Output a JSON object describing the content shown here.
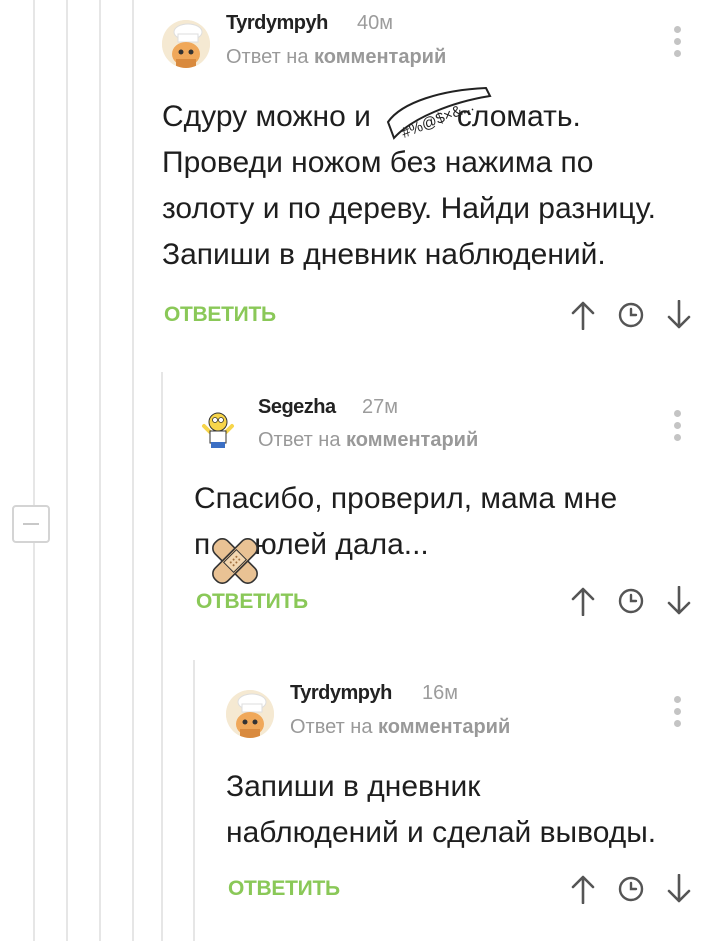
{
  "comments": [
    {
      "author": "Tyrdympyh",
      "time": "40м",
      "reply_prefix": "Ответ на",
      "reply_link": "комментарий",
      "body": [
        "Сдуру можно и",
        "сломать.",
        "Проведи ножом без нажима по",
        "золоту и по дереву. Найди разницу.",
        "Запиши в дневник наблюдений."
      ],
      "censor_sticker": "#%@$×&...",
      "reply_button": "ОТВЕТИТЬ",
      "avatar_icon": "chef-cat-avatar-icon"
    },
    {
      "author": "Segezha",
      "time": "27м",
      "reply_prefix": "Ответ на",
      "reply_link": "комментарий",
      "body": [
        "Спасибо, проверил, мама мне",
        "п",
        "юлей дала..."
      ],
      "censor_sticker": "band-aid-icon",
      "reply_button": "ОТВЕТИТЬ",
      "avatar_icon": "homer-avatar-icon"
    },
    {
      "author": "Tyrdympyh",
      "time": "16м",
      "reply_prefix": "Ответ на",
      "reply_link": "комментарий",
      "body": [
        "Запиши в дневник",
        "наблюдений и сделай выводы."
      ],
      "reply_button": "ОТВЕТИТЬ",
      "avatar_icon": "chef-cat-avatar-icon"
    }
  ],
  "colors": {
    "accent_green": "#8ac858",
    "thread_line": "#e6e6e6",
    "muted_text": "#999999"
  },
  "icons": {
    "upvote": "arrow-up-icon",
    "save": "clock-icon",
    "downvote": "arrow-down-icon",
    "more": "more-vertical-icon",
    "collapse": "collapse-minus-icon"
  }
}
